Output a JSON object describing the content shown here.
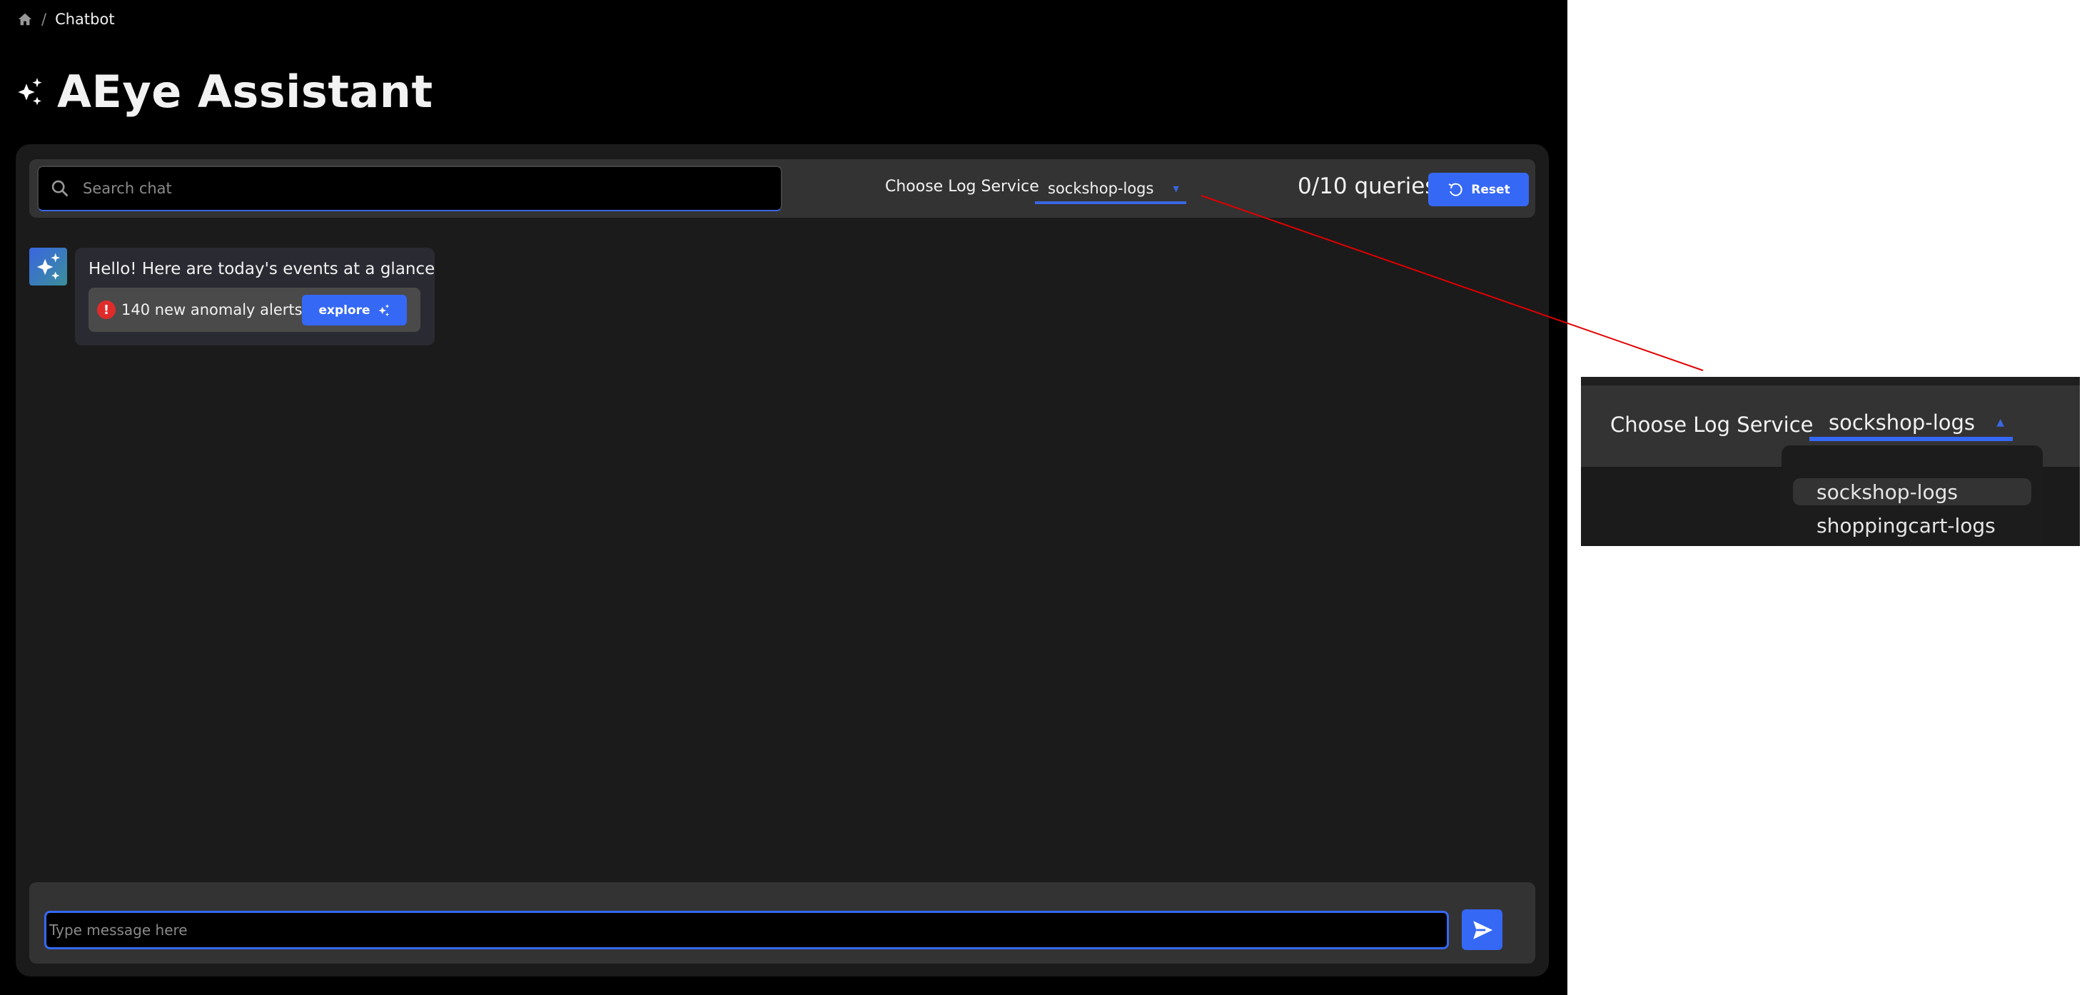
{
  "breadcrumb": {
    "home_icon": "home-icon",
    "separator": "/",
    "current": "Chatbot"
  },
  "header": {
    "title": "AEye Assistant",
    "icon": "sparkles-icon"
  },
  "toolbar": {
    "search_placeholder": "Search chat",
    "log_service_label": "Choose Log Service",
    "log_service_value": "sockshop-logs",
    "queries": "0/10 queries",
    "reset_label": "Reset"
  },
  "messages": [
    {
      "sender": "assistant",
      "text": "Hello! Here are today's events at a glance",
      "alert_text": "140 new anomaly alerts",
      "alert_icon": "!",
      "button": "explore"
    }
  ],
  "composer": {
    "placeholder": "Type message here",
    "send_icon": "send-icon"
  },
  "inset": {
    "label": "Choose Log Service",
    "value": "sockshop-logs",
    "options": [
      "sockshop-logs",
      "shoppingcart-logs"
    ],
    "selected_index": 0
  },
  "colors": {
    "accent": "#3568f5",
    "alert": "#e02b2b",
    "annotation_line": "#e00000"
  }
}
